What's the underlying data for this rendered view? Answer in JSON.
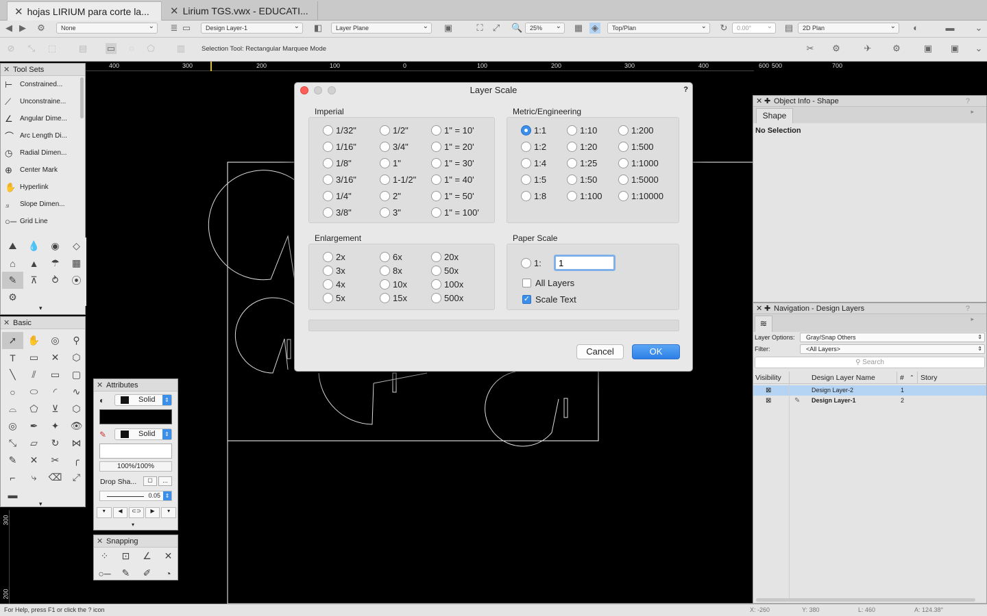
{
  "tabs": [
    {
      "label": "hojas LIRIUM para corte la..."
    },
    {
      "label": "Lirium TGS.vwx - EDUCATI..."
    }
  ],
  "viewbar": {
    "class": "None",
    "layer": "Design Layer-1",
    "plane": "Layer Plane",
    "zoom": "25%",
    "view": "Top/Plan",
    "rotation": "0.00°",
    "render": "2D Plan"
  },
  "modebar": {
    "tool_hint": "Selection Tool: Rectangular Marquee Mode"
  },
  "ruler": {
    "h_labels": [
      "400",
      "300",
      "200",
      "100",
      "0",
      "100",
      "200",
      "300",
      "400",
      "500",
      "600",
      "700"
    ],
    "v_labels": [
      "300",
      "200"
    ]
  },
  "toolsets": {
    "title": "Tool Sets",
    "items": [
      "Constrained...",
      "Unconstraine...",
      "Angular Dime...",
      "Arc Length Di...",
      "Radial Dimen...",
      "Center Mark",
      "Hyperlink",
      "Slope Dimen...",
      "Grid Line"
    ]
  },
  "basic": {
    "title": "Basic"
  },
  "attributes": {
    "title": "Attributes",
    "fill_style": "Solid",
    "pen_style": "Solid",
    "opacity": "100%/100%",
    "drop_shadow": "Drop Sha...",
    "line_weight": "0.05"
  },
  "snapping": {
    "title": "Snapping"
  },
  "dialog": {
    "title": "Layer Scale",
    "help": "?",
    "imperial_label": "Imperial",
    "metric_label": "Metric/Engineering",
    "enlargement_label": "Enlargement",
    "paper_label": "Paper Scale",
    "imperial": [
      [
        "1/32\"",
        "1/2\"",
        "1\" = 10'"
      ],
      [
        "1/16\"",
        "3/4\"",
        "1\" = 20'"
      ],
      [
        "1/8\"",
        "1\"",
        "1\" = 30'"
      ],
      [
        "3/16\"",
        "1-1/2\"",
        "1\" = 40'"
      ],
      [
        "1/4\"",
        "2\"",
        "1\" = 50'"
      ],
      [
        "3/8\"",
        "3\"",
        "1\" = 100'"
      ]
    ],
    "metric": [
      [
        "1:1",
        "1:10",
        "1:200"
      ],
      [
        "1:2",
        "1:20",
        "1:500"
      ],
      [
        "1:4",
        "1:25",
        "1:1000"
      ],
      [
        "1:5",
        "1:50",
        "1:5000"
      ],
      [
        "1:8",
        "1:100",
        "1:10000"
      ]
    ],
    "metric_selected": "1:1",
    "enlargement": [
      [
        "2x",
        "6x",
        "20x"
      ],
      [
        "3x",
        "8x",
        "50x"
      ],
      [
        "4x",
        "10x",
        "100x"
      ],
      [
        "5x",
        "15x",
        "500x"
      ]
    ],
    "paper_prefix": "1:",
    "paper_value": "1",
    "all_layers_label": "All Layers",
    "all_layers_checked": false,
    "scale_text_label": "Scale Text",
    "scale_text_checked": true,
    "cancel": "Cancel",
    "ok": "OK"
  },
  "object_info": {
    "title": "Object Info - Shape",
    "tab": "Shape",
    "status": "No Selection"
  },
  "navigation": {
    "title": "Navigation - Design Layers",
    "layer_options_label": "Layer Options:",
    "layer_options_value": "Gray/Snap Others",
    "filter_label": "Filter:",
    "filter_value": "<All Layers>",
    "search_placeholder": "Search",
    "columns": [
      "Visibility",
      "Design Layer Name",
      "#",
      "Story"
    ],
    "rows": [
      {
        "name": "Design Layer-2",
        "num": "1",
        "selected": true,
        "active": false
      },
      {
        "name": "Design Layer-1",
        "num": "2",
        "selected": false,
        "active": true
      }
    ]
  },
  "status": {
    "help": "For Help, press F1 or click the ? icon",
    "x": "X: -260",
    "y": "Y: 380",
    "l": "L: 460",
    "a": "A: 124.38°"
  },
  "colors": {
    "accent": "#3b8eea",
    "canvas": "#000000",
    "selection": "#b5d3f3"
  }
}
